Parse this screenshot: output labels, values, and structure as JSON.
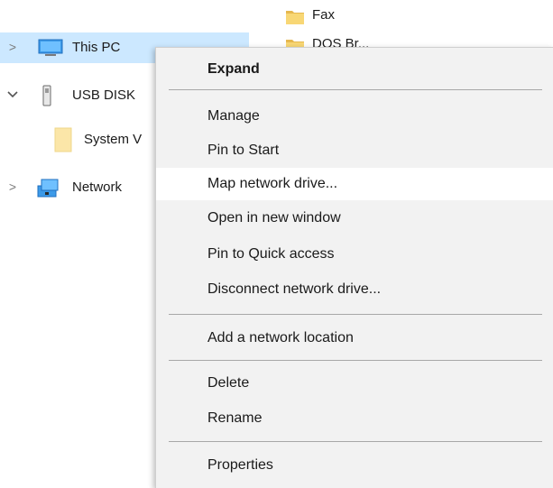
{
  "nav": {
    "items": [
      {
        "label": "This PC",
        "chevron": ">",
        "icon": "monitor-icon"
      },
      {
        "label": "USB DISK",
        "chevron": "v",
        "icon": "usb-drive-icon"
      },
      {
        "label": "System V",
        "chevron": "",
        "icon": "folder-icon"
      },
      {
        "label": "Network",
        "chevron": ">",
        "icon": "network-icon"
      }
    ]
  },
  "content": {
    "items": [
      {
        "label": "Fax",
        "icon": "folder-icon"
      },
      {
        "label": "DOS Br...",
        "icon": "folder-icon"
      }
    ]
  },
  "context_menu": {
    "items": [
      {
        "label": "Expand"
      },
      {
        "label": "Manage"
      },
      {
        "label": "Pin to Start"
      },
      {
        "label": "Map network drive..."
      },
      {
        "label": "Open in new window"
      },
      {
        "label": "Pin to Quick access"
      },
      {
        "label": "Disconnect network drive..."
      },
      {
        "label": "Add a network location"
      },
      {
        "label": "Delete"
      },
      {
        "label": "Rename"
      },
      {
        "label": "Properties"
      }
    ]
  },
  "colors": {
    "selection": "#cce8ff",
    "menu_background": "#f2f2f2",
    "menu_hover": "#ffffff",
    "folder": "#f8d775"
  }
}
